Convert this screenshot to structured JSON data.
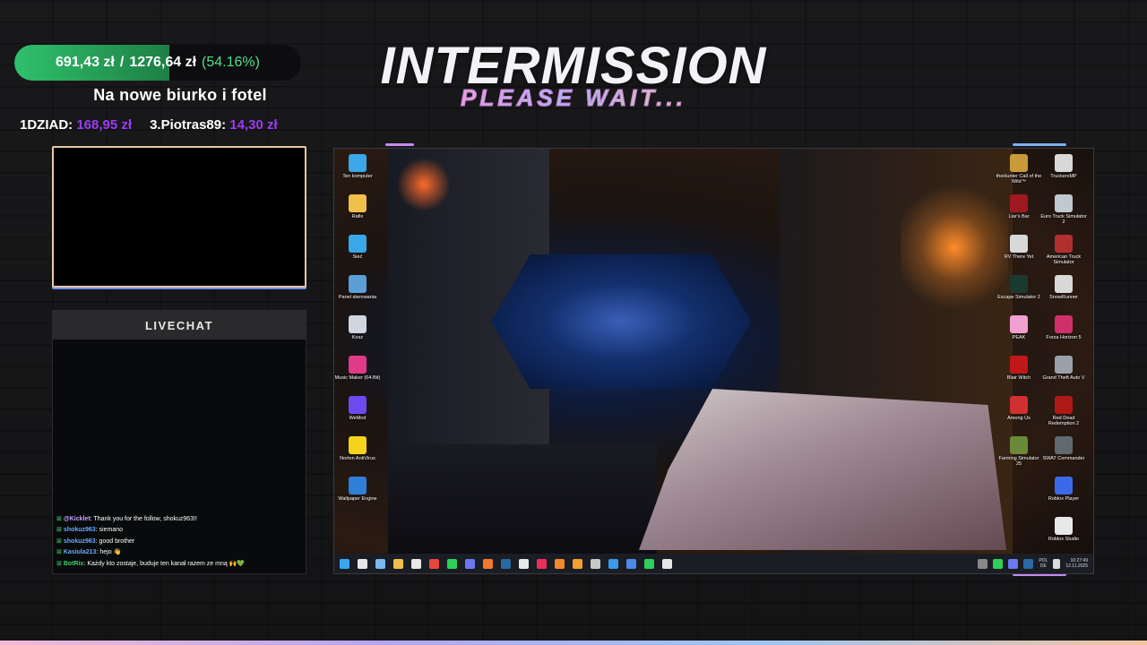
{
  "goal": {
    "current": "691,43 zł",
    "separator": "/",
    "target": "1276,64 zł",
    "percent_label": "(54.16%)",
    "progress_fraction": 0.5416,
    "title": "Na nowe biurko i fotel"
  },
  "top_donors": [
    {
      "name": "1DZIAD:",
      "amount": "168,95 zł"
    },
    {
      "name": "3.Piotras89:",
      "amount": "14,30 zł"
    }
  ],
  "banner": {
    "title": "INTERMISSION",
    "subtitle": "PLEASE WAIT..."
  },
  "chat": {
    "header": "LIVECHAT",
    "messages": [
      {
        "user": "@Kicklet",
        "user_color": "#c8a4ff",
        "text": ": Thank you for the follow, shokuz963!!"
      },
      {
        "user": "shokuz963",
        "user_color": "#6aa8ff",
        "text": ": siemano"
      },
      {
        "user": "shokuz963",
        "user_color": "#6aa8ff",
        "text": ": good brother"
      },
      {
        "user": "Kasiula213",
        "user_color": "#6aa8ff",
        "text": ": hejo 👋"
      },
      {
        "user": "BotRix",
        "user_color": "#3fd06b",
        "text": ": Każdy kto zostaje, buduje ten kanał razem ze mną 🙌💚"
      }
    ]
  },
  "desktop": {
    "left_icons": [
      {
        "label": "Ten komputer",
        "icon": "monitor-icon",
        "color": "#3aa7e8"
      },
      {
        "label": "Rafix",
        "icon": "folder-icon",
        "color": "#f1c04a"
      },
      {
        "label": "Sieć",
        "icon": "network-icon",
        "color": "#3aa7e8"
      },
      {
        "label": "Panel sterowania",
        "icon": "control-panel-icon",
        "color": "#5aa0d8"
      },
      {
        "label": "Kosz",
        "icon": "recycle-bin-icon",
        "color": "#cfd6df"
      },
      {
        "label": "Music Maker (64-Bit)",
        "icon": "music-maker-icon",
        "color": "#e23a8a"
      },
      {
        "label": "WeMod",
        "icon": "wemod-icon",
        "color": "#6b4bf0"
      },
      {
        "label": "Norton AntiVirus",
        "icon": "norton-icon",
        "color": "#f5d21b"
      },
      {
        "label": "Wallpaper Engine",
        "icon": "wallpaper-engine-icon",
        "color": "#2f7fd8"
      }
    ],
    "right_icons_col1": [
      {
        "label": "theHunter Call of the Wild™",
        "icon": "thehunter-icon",
        "color": "#c89a3a"
      },
      {
        "label": "Liar's Bar",
        "icon": "liars-bar-icon",
        "color": "#a01820"
      },
      {
        "label": "RV There Yet",
        "icon": "rv-there-yet-icon",
        "color": "#d8d8d8"
      },
      {
        "label": "Escape Simulator 2",
        "icon": "escape-simulator-icon",
        "color": "#1a3a30"
      },
      {
        "label": "PEAK",
        "icon": "peak-icon",
        "color": "#f0a0d0"
      },
      {
        "label": "Blair Witch",
        "icon": "blair-witch-icon",
        "color": "#c01818"
      },
      {
        "label": "Among Us",
        "icon": "among-us-icon",
        "color": "#d03030"
      },
      {
        "label": "Farming Simulator 25",
        "icon": "farming-simulator-icon",
        "color": "#6a8a3a"
      }
    ],
    "right_icons_col2": [
      {
        "label": "TruckersMP",
        "icon": "truckersmp-icon",
        "color": "#d8d8d8"
      },
      {
        "label": "Euro Truck Simulator 2",
        "icon": "ets2-icon",
        "color": "#c0c8d0"
      },
      {
        "label": "American Truck Simulator",
        "icon": "ats-icon",
        "color": "#b03030"
      },
      {
        "label": "SnowRunner",
        "icon": "snowrunner-icon",
        "color": "#d8d8d8"
      },
      {
        "label": "Forza Horizon 5",
        "icon": "forza-icon",
        "color": "#d0306a"
      },
      {
        "label": "Grand Theft Auto V",
        "icon": "gta-icon",
        "color": "#9aa0a8"
      },
      {
        "label": "Red Dead Redemption 2",
        "icon": "rdr2-icon",
        "color": "#b01818"
      },
      {
        "label": "SWAT Commander",
        "icon": "swat-icon",
        "color": "#606870"
      },
      {
        "label": "Roblox Player",
        "icon": "roblox-player-icon",
        "color": "#3a6ae8"
      },
      {
        "label": "Roblox Studio",
        "icon": "roblox-studio-icon",
        "color": "#e8e8e8"
      }
    ],
    "taskbar": {
      "apps": [
        {
          "icon": "windows-start-icon",
          "color": "#3aa7f0"
        },
        {
          "icon": "search-icon",
          "color": "#e8e8e8"
        },
        {
          "icon": "task-view-icon",
          "color": "#7ab8f0"
        },
        {
          "icon": "file-explorer-icon",
          "color": "#f1c04a"
        },
        {
          "icon": "calendar-icon",
          "color": "#e8e8e8"
        },
        {
          "icon": "chrome-icon",
          "color": "#e8453c"
        },
        {
          "icon": "whatsapp-icon",
          "color": "#2fd05a"
        },
        {
          "icon": "discord-icon",
          "color": "#6b7af0"
        },
        {
          "icon": "firefox-icon",
          "color": "#f07a2a"
        },
        {
          "icon": "steam-icon",
          "color": "#2a6aa0"
        },
        {
          "icon": "epic-games-icon",
          "color": "#e8e8e8"
        },
        {
          "icon": "tiktok-icon",
          "color": "#e8305a"
        },
        {
          "icon": "fl-studio-icon",
          "color": "#f08a2a"
        },
        {
          "icon": "app-a-icon",
          "color": "#f0a030"
        },
        {
          "icon": "camera-icon",
          "color": "#c8c8c8"
        },
        {
          "icon": "photos-icon",
          "color": "#3a9ae8"
        },
        {
          "icon": "store-icon",
          "color": "#4a8ae8"
        },
        {
          "icon": "spotify-icon",
          "color": "#2fd05a"
        },
        {
          "icon": "obs-icon",
          "color": "#e8e8e8"
        }
      ],
      "language": "POL",
      "language_sub": "DE",
      "time": "10:27:49",
      "date": "12.11.2025"
    }
  },
  "colors": {
    "goal_fill": "#2fc16c",
    "donor_amount": "#9b3cf0",
    "goal_percent": "#4ee08a"
  }
}
